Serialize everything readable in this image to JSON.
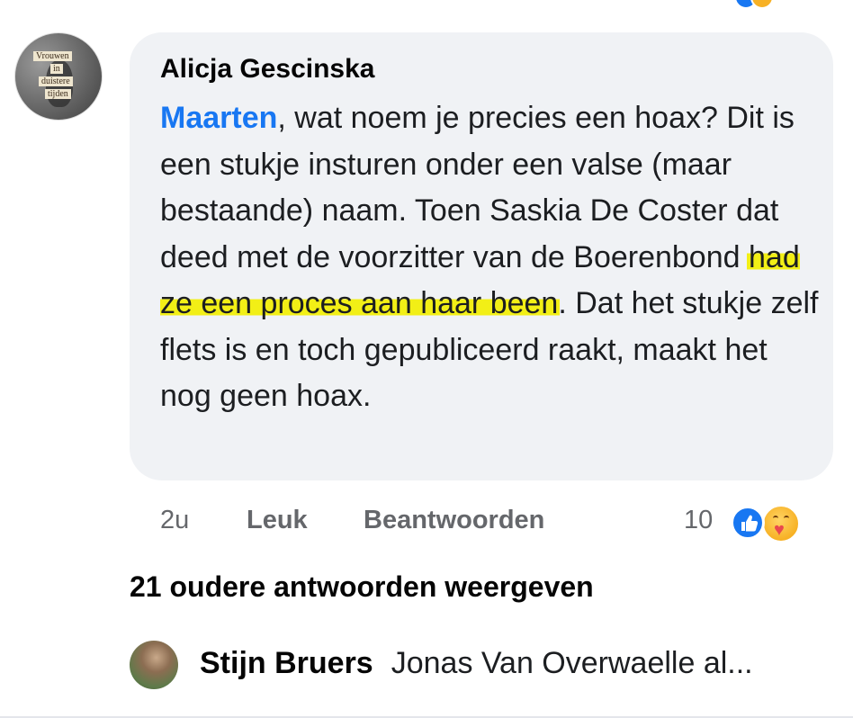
{
  "top_reactions": {
    "icons": [
      "like-icon",
      "care-icon"
    ]
  },
  "comment": {
    "avatar": {
      "icon": "book-cover-avatar",
      "cover_lines": [
        "Vrouwen",
        "in",
        "duistere",
        "tijden"
      ]
    },
    "author": "Alicja Gescinska",
    "mention": "Maarten",
    "text_part1": ", wat noem je precies een hoax? Dit is een stukje insturen onder een valse (maar bestaande) naam. Toen Saskia De Coster dat deed met de voorzitter van de Boerenbond ",
    "highlighted": "had ze een proces aan haar been",
    "text_part2": ". Dat het stukje zelf flets is en toch gepubliceerd raakt, maakt het nog geen hoax.",
    "highlight_color": "#f2ef16",
    "actions": {
      "time": "2u",
      "like_label": "Leuk",
      "reply_label": "Beantwoorden",
      "reaction_count": "10",
      "reaction_icons": [
        "like-icon",
        "care-icon"
      ]
    }
  },
  "older_replies_label": "21 oudere antwoorden weergeven",
  "reply_preview": {
    "author": "Stijn Bruers",
    "text": "Jonas Van Overwaelle al..."
  },
  "colors": {
    "bubble_bg": "#f0f2f5",
    "mention": "#1877f2",
    "meta_text": "#65676b",
    "like_blue": "#1877f2"
  }
}
